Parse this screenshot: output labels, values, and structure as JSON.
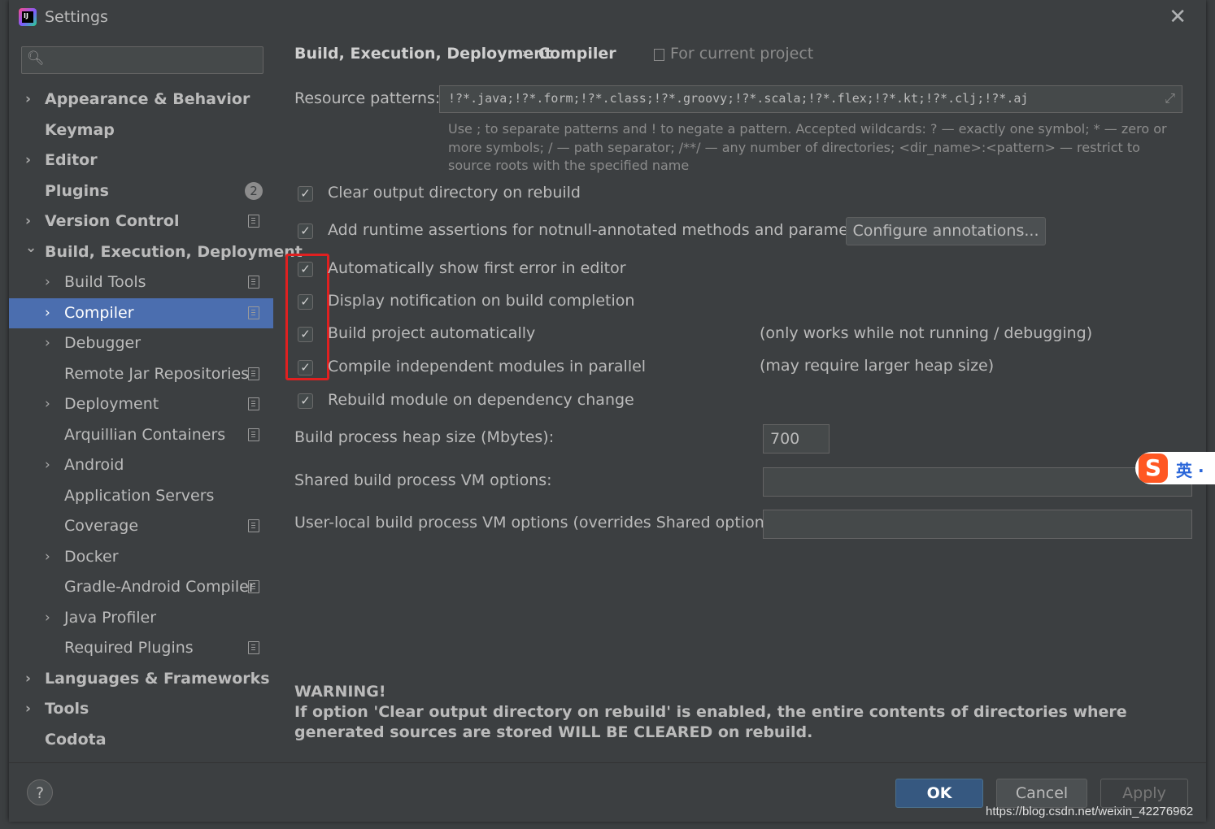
{
  "window": {
    "title": "Settings"
  },
  "search": {
    "placeholder": ""
  },
  "sidebar": {
    "items": [
      {
        "label": "Appearance & Behavior",
        "level": 0,
        "chevron": "right"
      },
      {
        "label": "Keymap",
        "level": 0
      },
      {
        "label": "Editor",
        "level": 0,
        "chevron": "right"
      },
      {
        "label": "Plugins",
        "level": 0,
        "badge": "2"
      },
      {
        "label": "Version Control",
        "level": 0,
        "chevron": "right",
        "project": true
      },
      {
        "label": "Build, Execution, Deployment",
        "level": 0,
        "chevron": "down"
      },
      {
        "label": "Build Tools",
        "level": 1,
        "chevron": "right",
        "project": true
      },
      {
        "label": "Compiler",
        "level": 1,
        "chevron": "right",
        "project": true,
        "selected": true
      },
      {
        "label": "Debugger",
        "level": 1,
        "chevron": "right"
      },
      {
        "label": "Remote Jar Repositories",
        "level": 1,
        "project": true
      },
      {
        "label": "Deployment",
        "level": 1,
        "chevron": "right",
        "project": true
      },
      {
        "label": "Arquillian Containers",
        "level": 1,
        "project": true
      },
      {
        "label": "Android",
        "level": 1,
        "chevron": "right"
      },
      {
        "label": "Application Servers",
        "level": 1
      },
      {
        "label": "Coverage",
        "level": 1,
        "project": true
      },
      {
        "label": "Docker",
        "level": 1,
        "chevron": "right"
      },
      {
        "label": "Gradle-Android Compiler",
        "level": 1,
        "project": true
      },
      {
        "label": "Java Profiler",
        "level": 1,
        "chevron": "right"
      },
      {
        "label": "Required Plugins",
        "level": 1,
        "project": true
      },
      {
        "label": "Languages & Frameworks",
        "level": 0,
        "chevron": "right"
      },
      {
        "label": "Tools",
        "level": 0,
        "chevron": "right"
      },
      {
        "label": "Codota",
        "level": 0
      }
    ]
  },
  "header": {
    "breadcrumb_parent": "Build, Execution, Deployment",
    "breadcrumb_sep": "›",
    "breadcrumb_current": "Compiler",
    "scope": "For current project"
  },
  "resource": {
    "label": "Resource patterns:",
    "value": "!?*.java;!?*.form;!?*.class;!?*.groovy;!?*.scala;!?*.flex;!?*.kt;!?*.clj;!?*.aj",
    "hint": "Use ; to separate patterns and ! to negate a pattern. Accepted wildcards: ? — exactly one symbol; * — zero or more symbols; / — path separator; /**/ — any number of directories; <dir_name>:<pattern> — restrict to source roots with the specified name"
  },
  "checkboxes": [
    {
      "label": "Clear output directory on rebuild",
      "checked": true
    },
    {
      "label": "Add runtime assertions for notnull-annotated methods and parameters",
      "checked": true
    },
    {
      "label": "Automatically show first error in editor",
      "checked": true
    },
    {
      "label": "Display notification on build completion",
      "checked": true
    },
    {
      "label": "Build project automatically",
      "checked": true,
      "note": "(only works while not running / debugging)"
    },
    {
      "label": "Compile independent modules in parallel",
      "checked": true,
      "note": "(may require larger heap size)"
    },
    {
      "label": "Rebuild module on dependency change",
      "checked": true
    }
  ],
  "configure_button": "Configure annotations...",
  "fields": {
    "heap_label": "Build process heap size (Mbytes):",
    "heap_value": "700",
    "shared_label": "Shared build process VM options:",
    "shared_value": "",
    "local_label": "User-local build process VM options (overrides Shared options):",
    "local_value": ""
  },
  "warning": {
    "title": "WARNING!",
    "text": "If option 'Clear output directory on rebuild' is enabled, the entire contents of directories where generated sources are stored WILL BE CLEARED on rebuild."
  },
  "footer": {
    "help": "?",
    "ok": "OK",
    "cancel": "Cancel",
    "apply": "Apply"
  },
  "overlay": {
    "watermark": "https://blog.csdn.net/weixin_42276962",
    "ime_logo": "S",
    "ime_lang": "英 ·"
  },
  "colors": {
    "selection": "#4b6eaf",
    "ok_button": "#365880",
    "highlight_box": "#e02020"
  }
}
